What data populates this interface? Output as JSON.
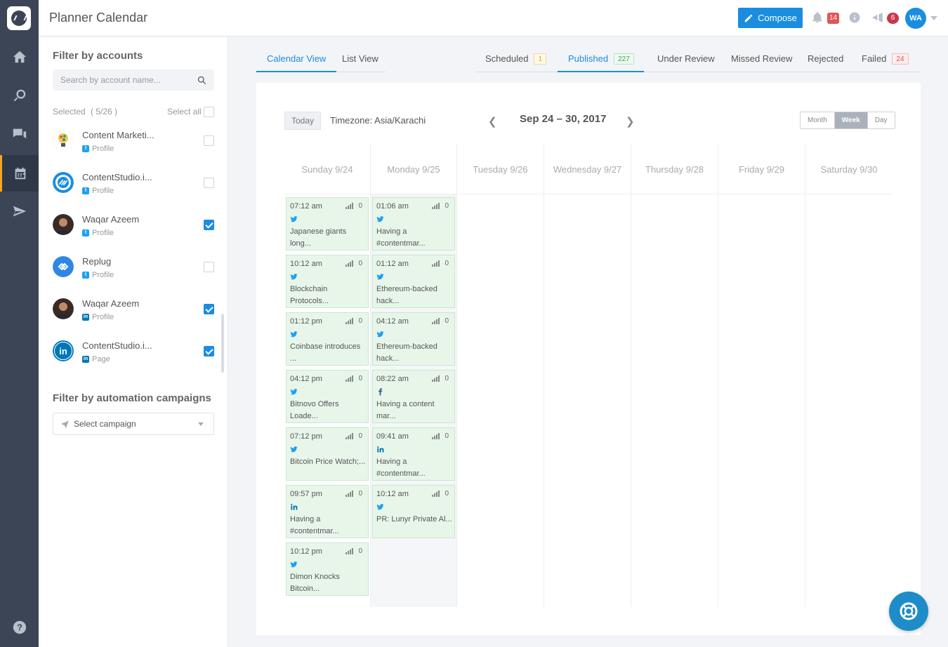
{
  "app": {
    "title": "Planner Calendar"
  },
  "rail": {
    "items": [
      "home-icon",
      "search-icon",
      "chat-icon",
      "calendar-icon",
      "send-icon"
    ],
    "help": "help-icon"
  },
  "header": {
    "compose_label": "Compose",
    "notifications_count": "14",
    "announcements_count": "6",
    "user_initials": "WA"
  },
  "filter": {
    "accounts_heading": "Filter by accounts",
    "search_placeholder": "Search by account name...",
    "selected_label": "Selected",
    "selected_count": "( 5/26 )",
    "select_all_label": "Select all",
    "accounts": [
      {
        "name": "Content Marketi...",
        "type": "Profile",
        "network": "twitter",
        "checked": false
      },
      {
        "name": "ContentStudio.i...",
        "type": "Profile",
        "network": "twitter",
        "checked": false
      },
      {
        "name": "Waqar Azeem",
        "type": "Profile",
        "network": "twitter",
        "checked": true
      },
      {
        "name": "Replug",
        "type": "Profile",
        "network": "twitter",
        "checked": false
      },
      {
        "name": "Waqar Azeem",
        "type": "Profile",
        "network": "linkedin",
        "checked": true
      },
      {
        "name": "ContentStudio.i...",
        "type": "Page",
        "network": "linkedin",
        "checked": true
      }
    ],
    "campaigns_heading": "Filter by automation campaigns",
    "campaign_placeholder": "Select campaign"
  },
  "view_tabs": [
    "Calendar View",
    "List View"
  ],
  "status_tabs": [
    {
      "label": "Scheduled",
      "count": "1"
    },
    {
      "label": "Published",
      "count": "227"
    },
    {
      "label": "Under Review",
      "count": ""
    },
    {
      "label": "Missed Review",
      "count": ""
    },
    {
      "label": "Rejected",
      "count": ""
    },
    {
      "label": "Failed",
      "count": "24"
    }
  ],
  "calendar": {
    "today_label": "Today",
    "timezone": "Timezone: Asia/Karachi",
    "range": "Sep 24 – 30, 2017",
    "view_modes": [
      "Month",
      "Week",
      "Day"
    ],
    "active_view": "Week",
    "days": [
      "Sunday 9/24",
      "Monday 9/25",
      "Tuesday 9/26",
      "Wednesday 9/27",
      "Thursday 9/28",
      "Friday 9/29",
      "Saturday 9/30"
    ],
    "posts": {
      "sunday": [
        {
          "time": "07:12 am",
          "count": "0",
          "network": "twitter",
          "lines": [
            "Japanese giants",
            "long..."
          ]
        },
        {
          "time": "10:12 am",
          "count": "0",
          "network": "twitter",
          "lines": [
            "Blockchain",
            "Protocols..."
          ]
        },
        {
          "time": "01:12 pm",
          "count": "0",
          "network": "twitter",
          "lines": [
            "Coinbase introduces",
            "..."
          ]
        },
        {
          "time": "04:12 pm",
          "count": "0",
          "network": "twitter",
          "lines": [
            "Bitnovo Offers",
            "Loade..."
          ]
        },
        {
          "time": "07:12 pm",
          "count": "0",
          "network": "twitter",
          "lines": [
            "Bitcoin Price Watch;...",
            ""
          ]
        },
        {
          "time": "09:57 pm",
          "count": "0",
          "network": "linkedin",
          "lines": [
            "Having a",
            "#contentmar..."
          ]
        },
        {
          "time": "10:12 pm",
          "count": "0",
          "network": "twitter",
          "lines": [
            "Dimon Knocks",
            "Bitcoin..."
          ]
        }
      ],
      "monday": [
        {
          "time": "01:06 am",
          "count": "0",
          "network": "twitter",
          "lines": [
            "Having a",
            "#contentmar..."
          ]
        },
        {
          "time": "01:12 am",
          "count": "0",
          "network": "twitter",
          "lines": [
            "Ethereum-backed",
            "hack..."
          ]
        },
        {
          "time": "04:12 am",
          "count": "0",
          "network": "twitter",
          "lines": [
            "Ethereum-backed",
            "hack..."
          ]
        },
        {
          "time": "08:22 am",
          "count": "0",
          "network": "facebook",
          "lines": [
            "Having a content",
            "mar..."
          ]
        },
        {
          "time": "09:41 am",
          "count": "0",
          "network": "linkedin",
          "lines": [
            "Having a",
            "#contentmar..."
          ]
        },
        {
          "time": "10:12 am",
          "count": "0",
          "network": "twitter",
          "lines": [
            "PR: Lunyr Private Al...",
            ""
          ]
        }
      ]
    }
  },
  "colors": {
    "accent": "#1a8de0",
    "rail": "#3b4556",
    "published_bg": "#e8f6ea",
    "twitter": "#1da1f2",
    "linkedin": "#0077b5",
    "facebook": "#3b5998"
  }
}
